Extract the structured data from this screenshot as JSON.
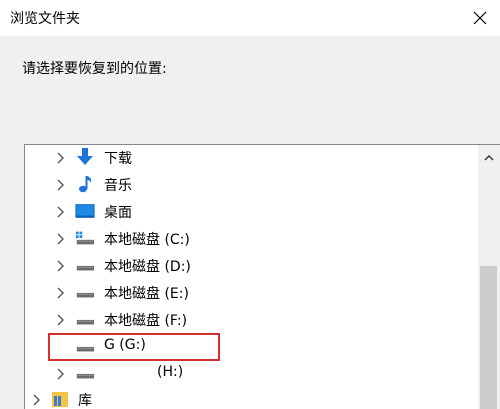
{
  "window": {
    "title": "浏览文件夹"
  },
  "dialog": {
    "prompt": "请选择要恢复到的位置:"
  },
  "tree": {
    "items": [
      {
        "label": "下载",
        "icon": "download-arrow-icon"
      },
      {
        "label": "音乐",
        "icon": "music-note-icon"
      },
      {
        "label": "桌面",
        "icon": "desktop-icon"
      },
      {
        "label": "本地磁盘 (C:)",
        "icon": "windows-drive-icon"
      },
      {
        "label": "本地磁盘 (D:)",
        "icon": "drive-icon"
      },
      {
        "label": "本地磁盘 (E:)",
        "icon": "drive-icon"
      },
      {
        "label": "本地磁盘 (F:)",
        "icon": "drive-icon"
      },
      {
        "label": "G (G:)",
        "icon": "drive-icon",
        "selected_highlight": true
      },
      {
        "label": "(H:)",
        "icon": "drive-icon"
      },
      {
        "label": "库",
        "icon": "library-folder-icon"
      }
    ]
  },
  "colors": {
    "highlight_border": "#d32f2f",
    "download_icon": "#1e73d8",
    "music_icon": "#1e73d8",
    "desktop_icon": "#1e88e5",
    "library_icon": "#f5c445"
  }
}
